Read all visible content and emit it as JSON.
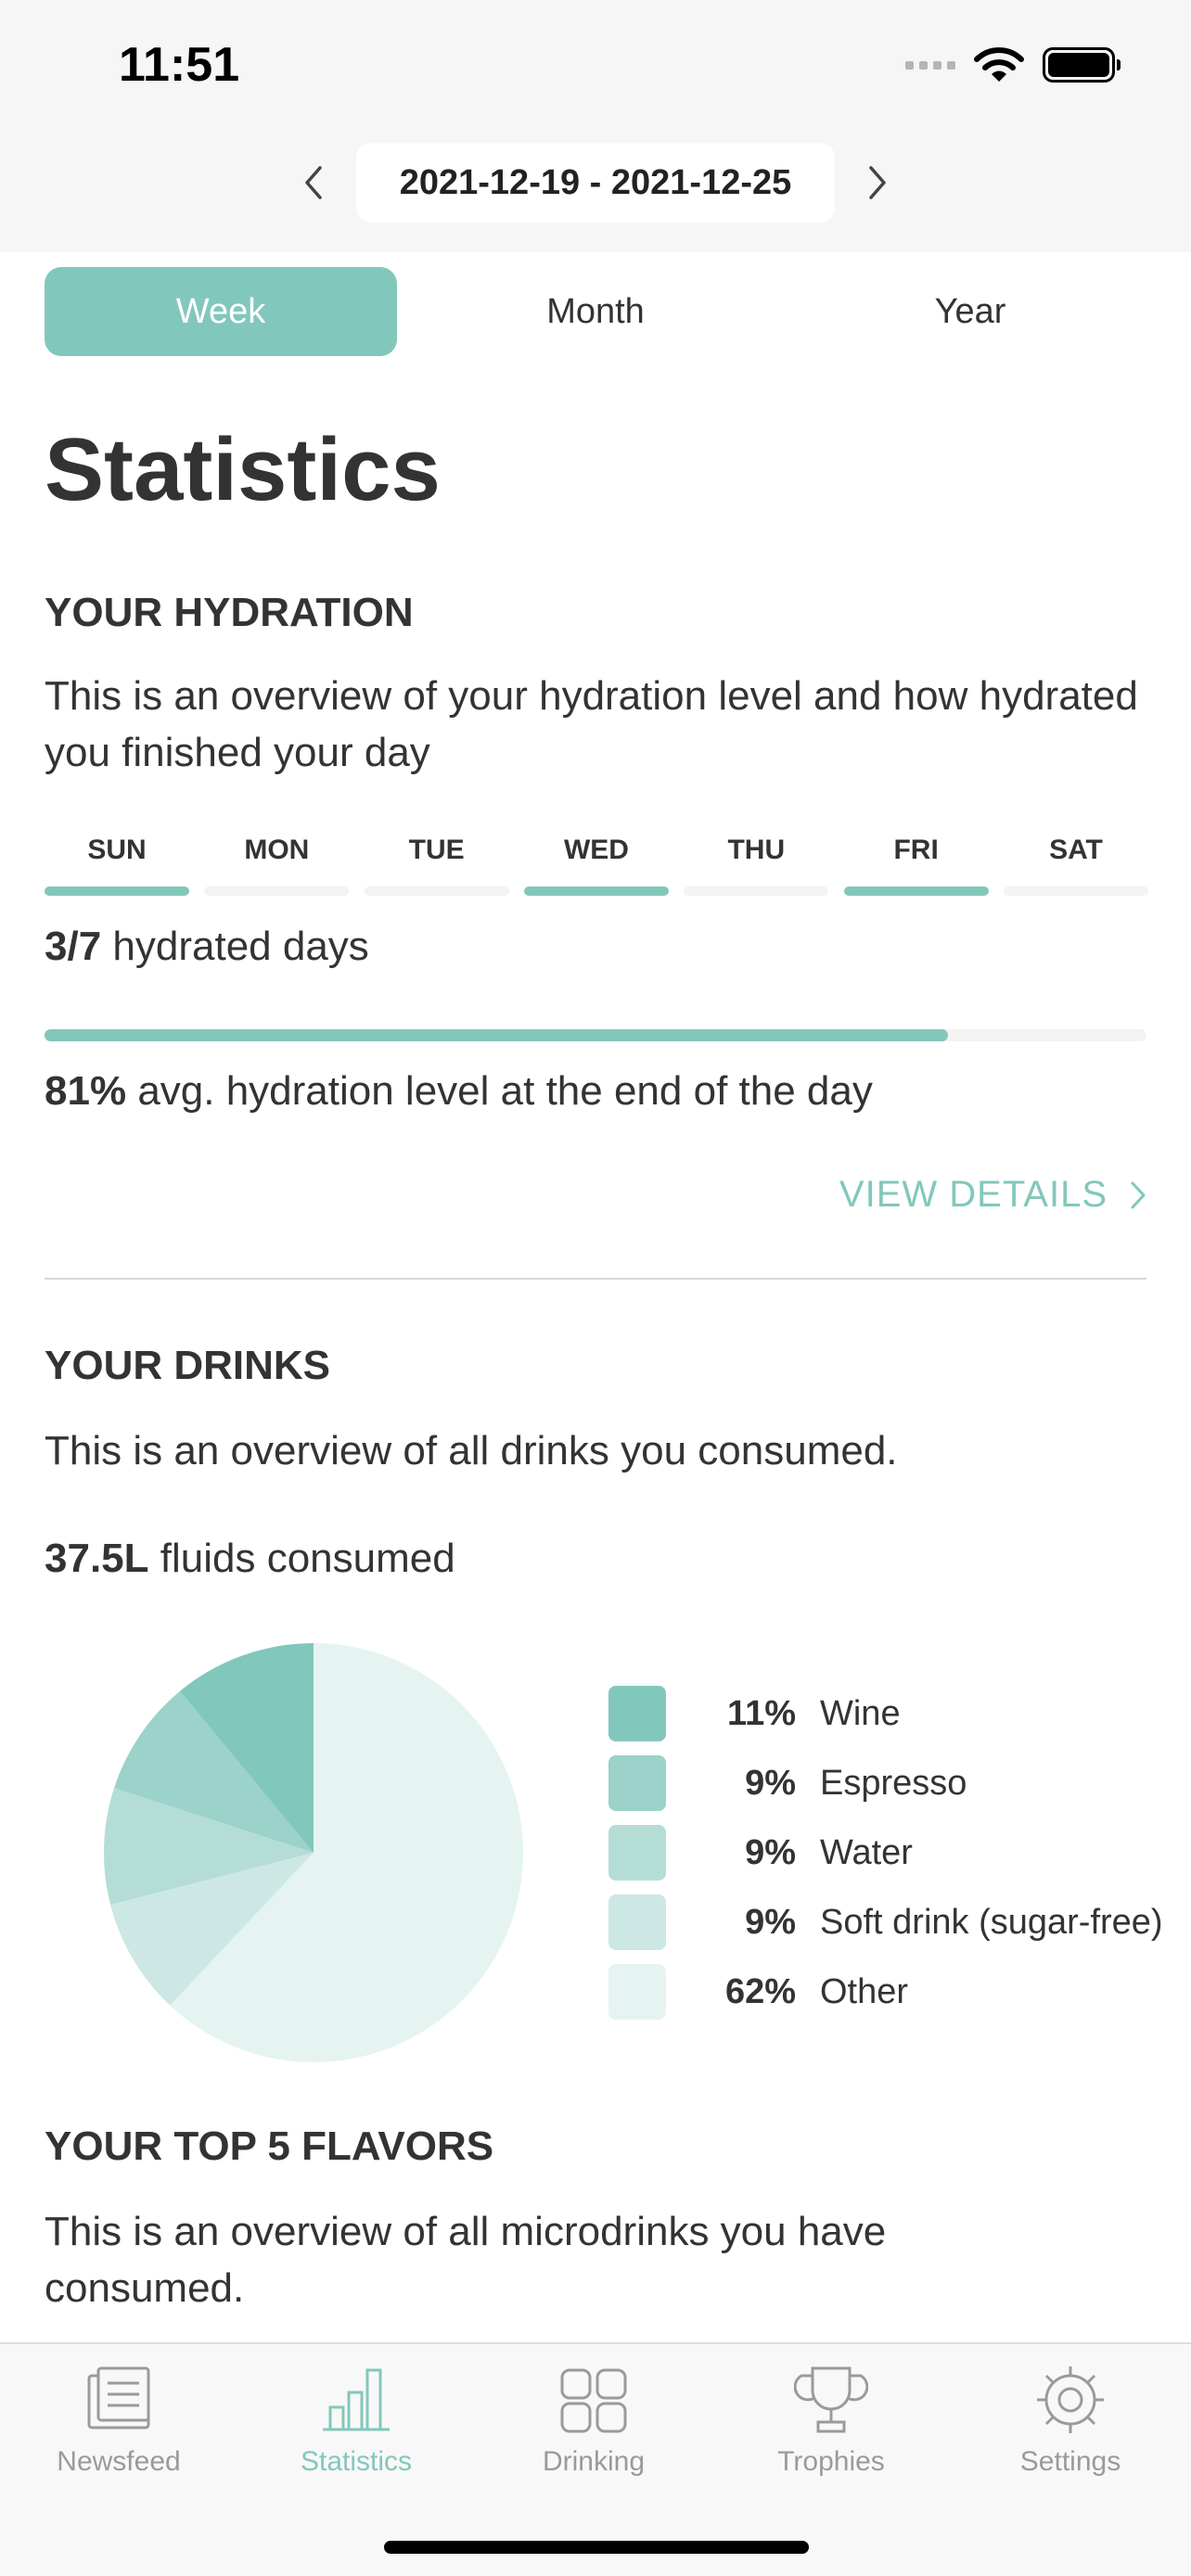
{
  "status_bar": {
    "time": "11:51"
  },
  "date_range": {
    "label": "2021-12-19 - 2021-12-25"
  },
  "period_tabs": [
    {
      "label": "Week",
      "active": true
    },
    {
      "label": "Month",
      "active": false
    },
    {
      "label": "Year",
      "active": false
    }
  ],
  "page_title": "Statistics",
  "hydration": {
    "title": "YOUR HYDRATION",
    "description": "This is an overview of your hydration level and how hydrated you finished your day",
    "days": [
      {
        "label": "SUN",
        "hydrated": true
      },
      {
        "label": "MON",
        "hydrated": false
      },
      {
        "label": "TUE",
        "hydrated": false
      },
      {
        "label": "WED",
        "hydrated": true
      },
      {
        "label": "THU",
        "hydrated": false
      },
      {
        "label": "FRI",
        "hydrated": true
      },
      {
        "label": "SAT",
        "hydrated": false
      }
    ],
    "hydrated_days_value": "3/7",
    "hydrated_days_text": "hydrated days",
    "avg_level_value": "81%",
    "avg_level_text": "avg. hydration level at the end of the day",
    "avg_level_fraction": 0.82,
    "view_details": "VIEW DETAILS"
  },
  "drinks": {
    "title": "YOUR DRINKS",
    "description": "This is an overview of all drinks you consumed.",
    "fluids_value": "37.5L",
    "fluids_text": "fluids consumed",
    "breakdown": [
      {
        "pct": "11%",
        "name": "Wine",
        "value": 11,
        "color": "#82c7bc"
      },
      {
        "pct": "9%",
        "name": "Espresso",
        "value": 9,
        "color": "#9bd2c9"
      },
      {
        "pct": "9%",
        "name": "Water",
        "value": 9,
        "color": "#b4ddd6"
      },
      {
        "pct": "9%",
        "name": "Soft drink (sugar-free)",
        "value": 9,
        "color": "#cde8e4"
      },
      {
        "pct": "62%",
        "name": "Other",
        "value": 62,
        "color": "#e5f4f1"
      }
    ]
  },
  "flavors": {
    "title": "YOUR TOP 5 FLAVORS",
    "description": "This is an overview of all microdrinks you have consumed."
  },
  "colors": {
    "accent": "#82c7bc",
    "inactive_tab": "#9a9a9a"
  },
  "tab_bar": [
    {
      "label": "Newsfeed",
      "icon": "newspaper-icon",
      "active": false
    },
    {
      "label": "Statistics",
      "icon": "bar-chart-icon",
      "active": true
    },
    {
      "label": "Drinking",
      "icon": "drink-pods-icon",
      "active": false
    },
    {
      "label": "Trophies",
      "icon": "trophy-icon",
      "active": false
    },
    {
      "label": "Settings",
      "icon": "gear-icon",
      "active": false
    }
  ]
}
